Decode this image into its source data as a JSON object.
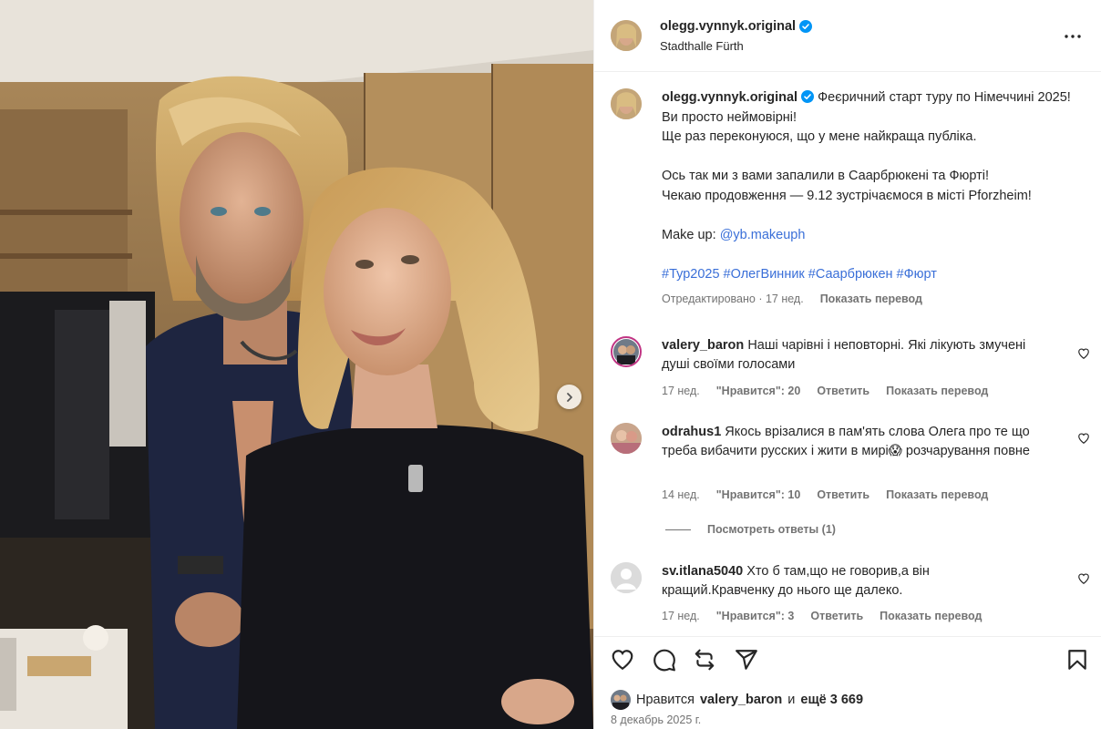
{
  "post": {
    "username": "olegg.vynnyk.original",
    "location": "Stadthalle Fürth",
    "caption_lines": [
      "Феєричний старт туру по Німеччині 2025!",
      "Ви просто неймовірні!",
      "Ще раз переконуюся, що у мене найкраща публіка.",
      "Ось так ми з вами запалили в Саарбрюкені та Фюрті!",
      "Чекаю продовження — 9.12 зустрічаємося в місті Pforzheim!",
      "Make up:",
      "@yb.makeuph",
      "#Тур2025 #ОлегВинник #Саарбрюкен #Фюрт"
    ],
    "caption_meta": {
      "edited": "Отредактировано · 17 нед.",
      "translate": "Показать перевод"
    }
  },
  "comments": [
    {
      "username": "valery_baron",
      "text": "Наші чарівні і неповторні. Які лікують змучені душі своїми голосами",
      "time": "17 нед.",
      "likes": "\"Нравится\": 20",
      "reply": "Ответить",
      "translate": "Показать перевод"
    },
    {
      "username": "odrahus1",
      "text": "Якось врізалися в пам'ять слова Олега про те що треба вибачити русских і жити в мирі😱  розчарування повне",
      "time": "14 нед.",
      "likes": "\"Нравится\": 10",
      "reply": "Ответить",
      "translate": "Показать перевод",
      "view_replies": "Посмотреть ответы (1)"
    },
    {
      "username": "sv.itlana5040",
      "text": "Хто б там,що не говорив,а він кращий.Кравченку до нього ще далеко.",
      "time": "17 нед.",
      "likes": "\"Нравится\": 3",
      "reply": "Ответить",
      "translate": "Показать перевод"
    }
  ],
  "likes": {
    "prefix": "Нравится",
    "user": "valery_baron",
    "middle": "и",
    "rest": "ещё 3 669"
  },
  "date": "8 декабрь 2025 г.",
  "icons": {
    "like": "heart-icon",
    "comment": "comment-icon",
    "repost": "repost-icon",
    "share": "share-icon",
    "save": "bookmark-icon",
    "more": "more-icon",
    "next": "chevron-right-icon",
    "verified": "verified-badge-icon"
  },
  "colors": {
    "verified": "#0095f6",
    "link": "#3a6fd8",
    "secondary_text": "#737373"
  }
}
